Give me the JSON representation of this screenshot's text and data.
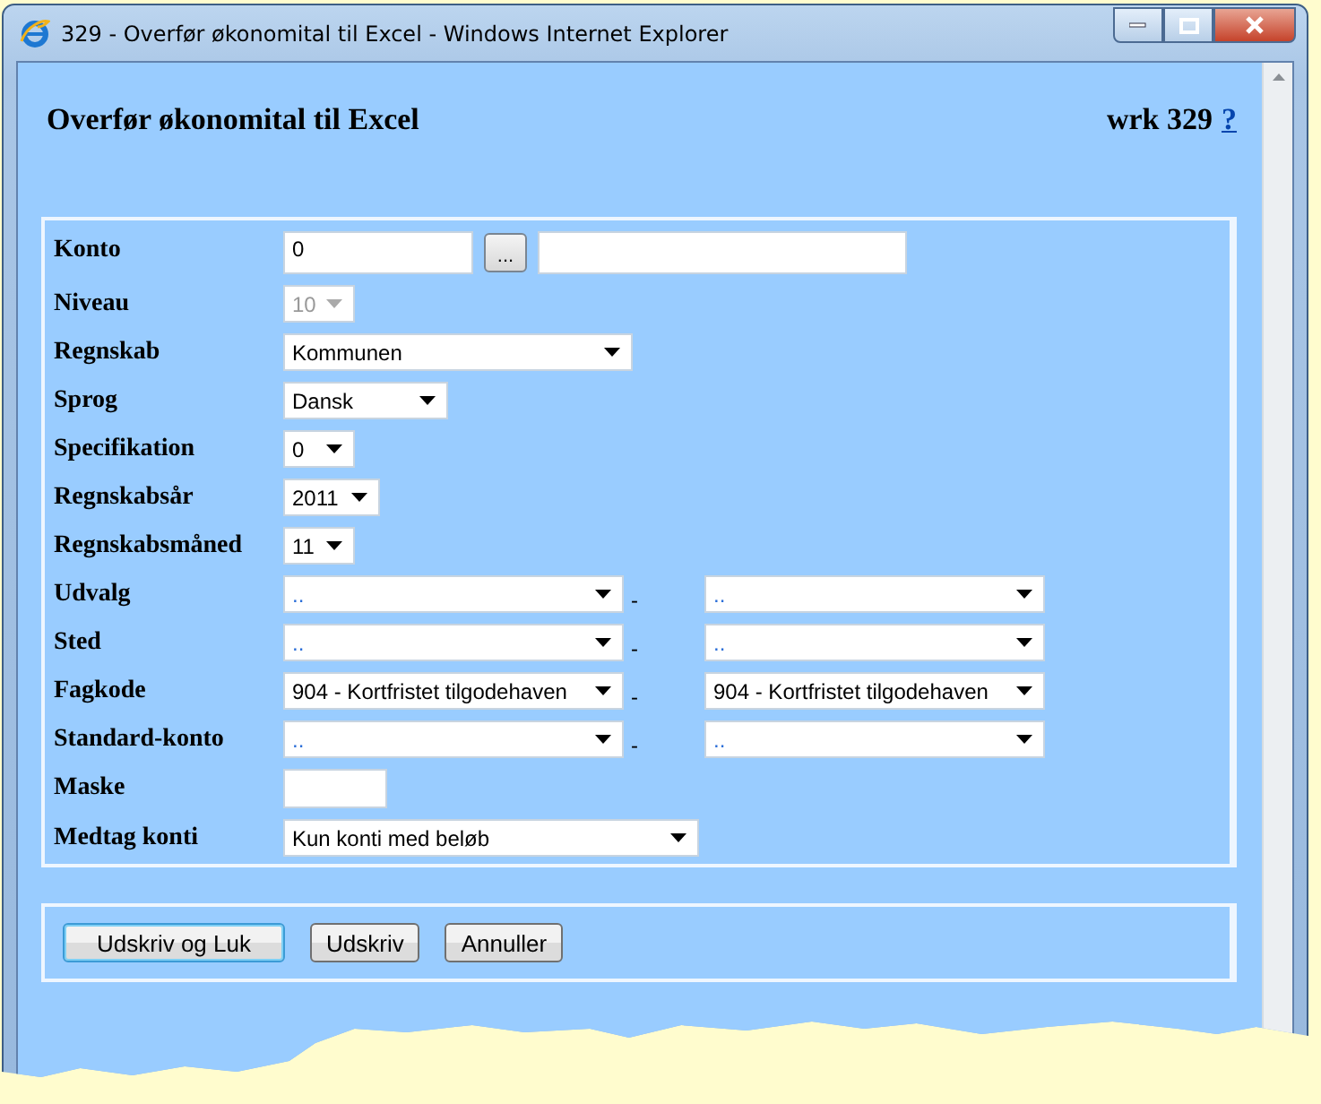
{
  "window": {
    "title": "329 - Overfør økonomital til Excel - Windows Internet Explorer"
  },
  "header": {
    "title": "Overfør økonomital til Excel",
    "code": "wrk 329",
    "help_link": "?"
  },
  "fields": [
    {
      "kind": "account",
      "label": "Konto",
      "value": "0",
      "lookup_button": "...",
      "disabled": false
    },
    {
      "kind": "select",
      "label": "Niveau",
      "value": "10",
      "disabled": true
    },
    {
      "kind": "select",
      "label": "Regnskab",
      "value": "Kommunen",
      "disabled": false
    },
    {
      "kind": "select",
      "label": "Sprog",
      "value": "Dansk",
      "disabled": false
    },
    {
      "kind": "select",
      "label": "Specifikation",
      "value": "0",
      "disabled": false
    },
    {
      "kind": "select",
      "label": "Regnskabsår",
      "value": "2011",
      "disabled": false
    },
    {
      "kind": "select",
      "label": "Regnskabsmåned",
      "value": "11",
      "disabled": false
    },
    {
      "kind": "range",
      "label": "Udvalg",
      "from": "..",
      "separator": "-",
      "to": "..",
      "disabled": false
    },
    {
      "kind": "range",
      "label": "Sted",
      "from": "..",
      "separator": "-",
      "to": "..",
      "disabled": false
    },
    {
      "kind": "range",
      "label": "Fagkode",
      "from": "904 - Kortfristet tilgodehaven",
      "separator": "-",
      "to": "904 - Kortfristet tilgodehaven",
      "disabled": false
    },
    {
      "kind": "range",
      "label": "Standard-konto",
      "from": "..",
      "separator": "-",
      "to": "..",
      "disabled": false
    },
    {
      "kind": "input",
      "label": "Maske",
      "disabled": false
    },
    {
      "kind": "select",
      "label": "Medtag konti",
      "value": "Kun konti med beløb",
      "disabled": false
    }
  ],
  "buttons": [
    {
      "label": "Udskriv og Luk",
      "default": true
    },
    {
      "label": "Udskriv",
      "default": false
    },
    {
      "label": "Annuller",
      "default": false
    }
  ]
}
